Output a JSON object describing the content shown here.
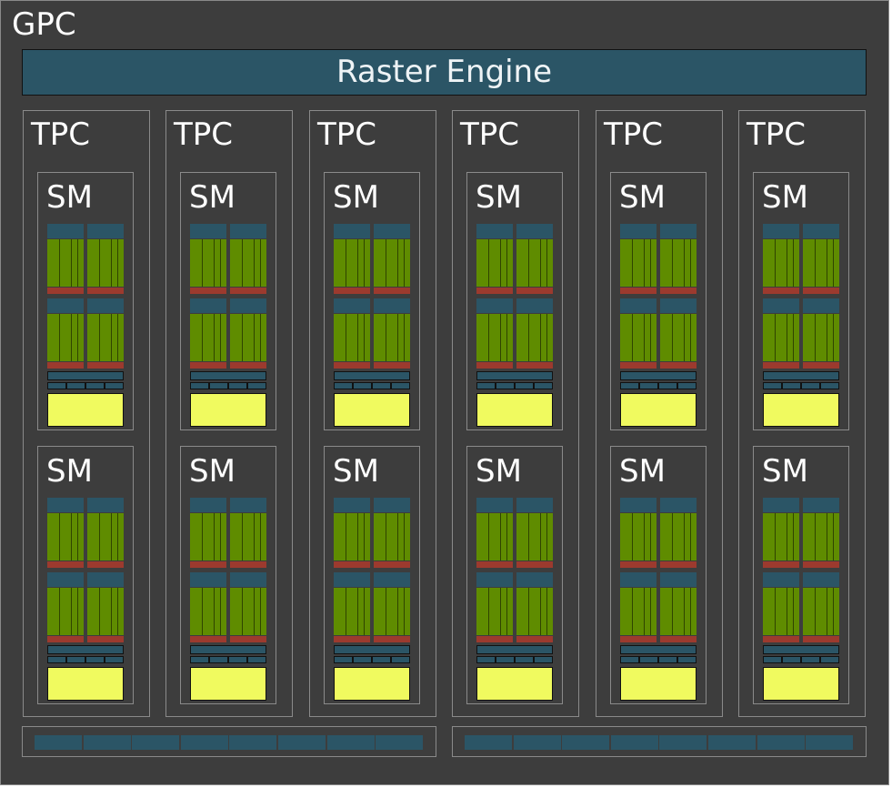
{
  "gpc": {
    "label": "GPC"
  },
  "raster_engine": {
    "label": "Raster Engine"
  },
  "tpcs": [
    {
      "label": "TPC",
      "sms": [
        {
          "label": "SM"
        },
        {
          "label": "SM"
        }
      ]
    },
    {
      "label": "TPC",
      "sms": [
        {
          "label": "SM"
        },
        {
          "label": "SM"
        }
      ]
    },
    {
      "label": "TPC",
      "sms": [
        {
          "label": "SM"
        },
        {
          "label": "SM"
        }
      ]
    },
    {
      "label": "TPC",
      "sms": [
        {
          "label": "SM"
        },
        {
          "label": "SM"
        }
      ]
    },
    {
      "label": "TPC",
      "sms": [
        {
          "label": "SM"
        },
        {
          "label": "SM"
        }
      ]
    },
    {
      "label": "TPC",
      "sms": [
        {
          "label": "SM"
        },
        {
          "label": "SM"
        }
      ]
    }
  ],
  "colors": {
    "background": "#3d3d3d",
    "raster_engine": "#2b5566",
    "cuda_cores": "#5f8c00",
    "register_file": "#9c3a2e",
    "cache": "#f0fa5f",
    "border": "#8a8a8a"
  }
}
